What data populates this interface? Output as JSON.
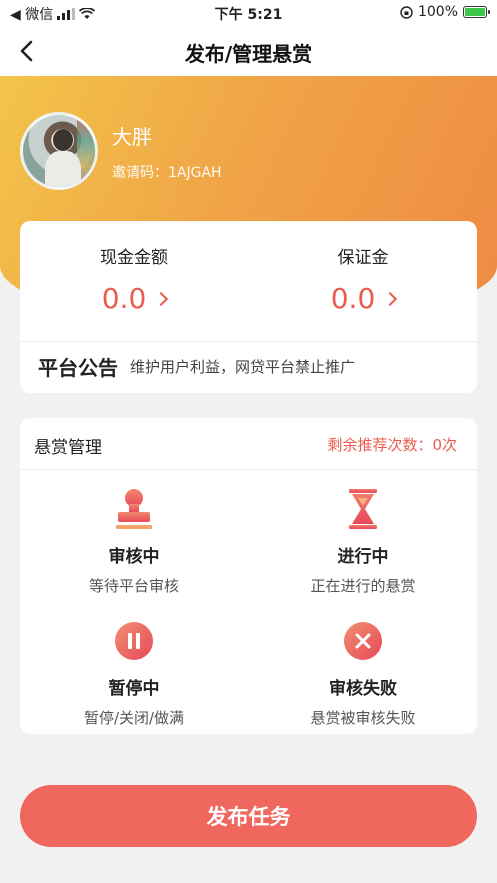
{
  "status_bar": {
    "carrier": "◀ 微信",
    "time": "下午 5:21",
    "battery": "100%"
  },
  "nav": {
    "title": "发布/管理悬赏"
  },
  "profile": {
    "name": "大胖",
    "invite": "邀请码：1AJGAH"
  },
  "money": {
    "cash_label": "现金金额",
    "cash_value": "0.0",
    "deposit_label": "保证金",
    "deposit_value": "0.0"
  },
  "notice": {
    "title": "平台公告",
    "text": "维护用户利益，网贷平台禁止推广"
  },
  "manage": {
    "title": "悬赏管理",
    "remaining": "剩余推荐次数：0次",
    "items": [
      {
        "name": "审核中",
        "desc": "等待平台审核",
        "icon": "stamp-icon"
      },
      {
        "name": "进行中",
        "desc": "正在进行的悬赏",
        "icon": "hourglass-icon"
      },
      {
        "name": "暂停中",
        "desc": "暂停/关闭/做满",
        "icon": "pause-icon"
      },
      {
        "name": "审核失败",
        "desc": "悬赏被审核失败",
        "icon": "fail-icon"
      }
    ]
  },
  "publish_button": "发布任务",
  "colors": {
    "accent": "#f0675e",
    "header_start": "#f3c44a",
    "header_end": "#ee8a43"
  }
}
